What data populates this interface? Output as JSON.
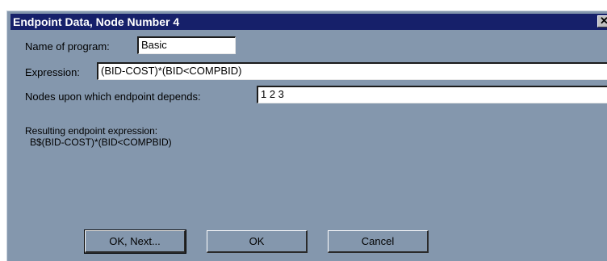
{
  "window": {
    "title": "Endpoint Data, Node Number 4",
    "close_glyph": "✕"
  },
  "program": {
    "label": "Name of program:",
    "value": "Basic"
  },
  "expression": {
    "label": "Expression:",
    "value": "(BID-COST)*(BID<COMPBID)"
  },
  "nodes": {
    "label": "Nodes upon which endpoint depends:",
    "value": "1 2 3"
  },
  "result": {
    "label": "Resulting endpoint expression:",
    "value": "B$(BID-COST)*(BID<COMPBID)"
  },
  "buttons": {
    "ok_next": "OK, Next...",
    "ok": "OK",
    "cancel": "Cancel"
  },
  "colors": {
    "dialog_bg": "#8497ad",
    "titlebar_bg": "#16206a"
  }
}
